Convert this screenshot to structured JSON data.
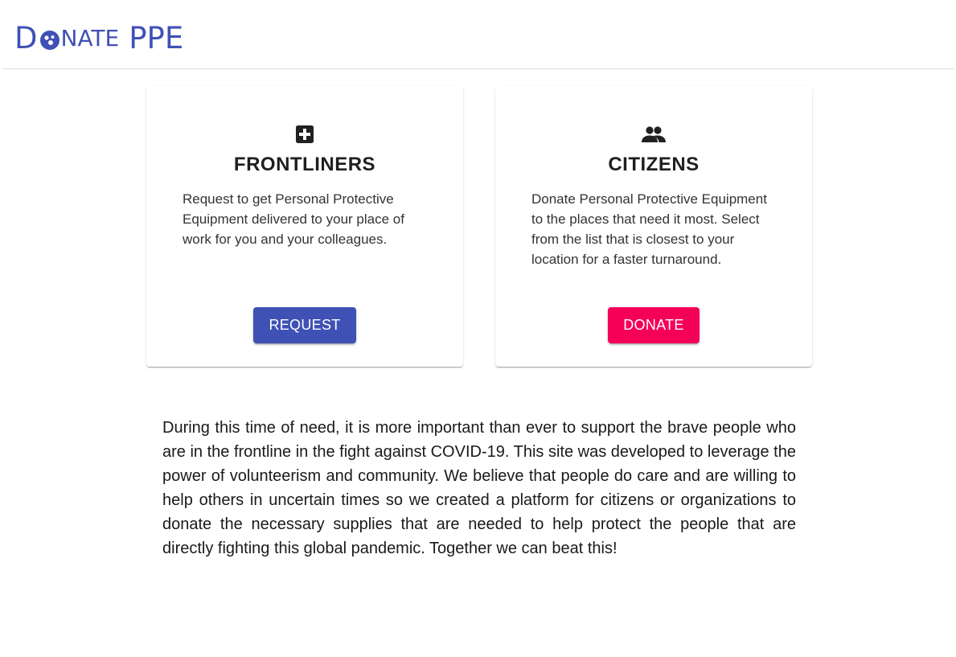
{
  "brand": {
    "logo_prefix": "D",
    "logo_rest": "NATE",
    "logo_suffix": "PPE",
    "color": "#3f51b5"
  },
  "cards": [
    {
      "icon": "medical-plus-icon",
      "title": "FRONTLINERS",
      "description": "Request to get Personal Protective Equipment delivered to your place of work for you and your colleagues.",
      "button_label": "REQUEST",
      "button_color": "#3f51b5"
    },
    {
      "icon": "people-icon",
      "title": "CITIZENS",
      "description": "Donate Personal Protective Equipment to the places that need it most. Select from the list that is closest to your location for a faster turnaround.",
      "button_label": "DONATE",
      "button_color": "#f50057"
    }
  ],
  "about": {
    "text": "During this time of need, it is more important than ever to support the brave people who are in the frontline in the fight against COVID-19. This site was developed to leverage the power of volunteerism and community. We believe that people do care and are willing to help others in uncertain times so we created a platform for citizens or organizations to donate the necessary supplies that are needed to help protect the people that are directly fighting this global pandemic. Together we can beat this!"
  }
}
